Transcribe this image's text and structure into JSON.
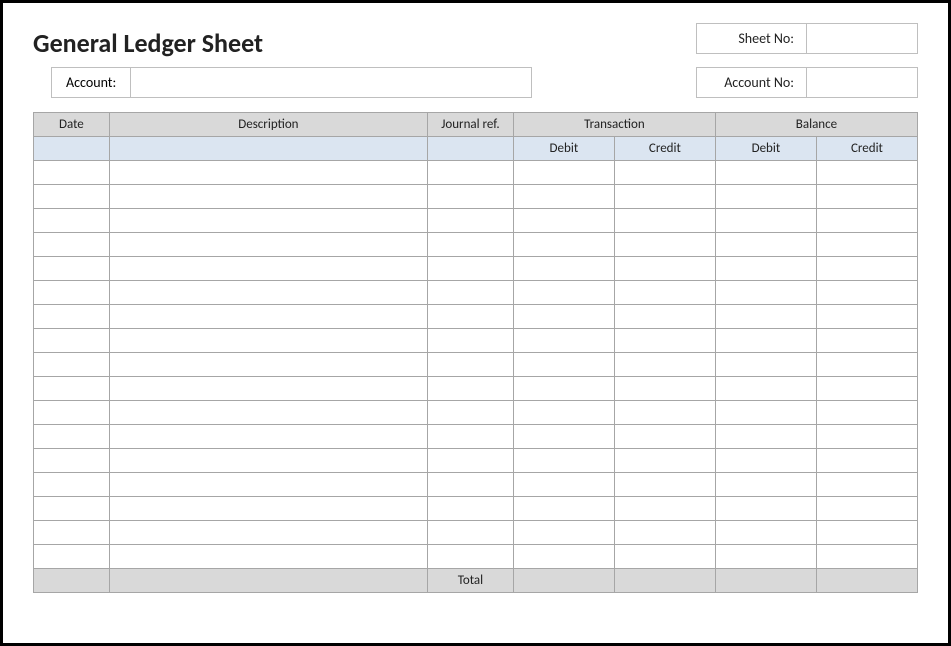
{
  "title": "General Ledger Sheet",
  "fields": {
    "sheet_no_label": "Sheet No:",
    "sheet_no_value": "",
    "account_label": "Account:",
    "account_value": "",
    "account_no_label": "Account No:",
    "account_no_value": ""
  },
  "columns": {
    "date": "Date",
    "description": "Description",
    "journal_ref": "Journal ref.",
    "transaction": "Transaction",
    "balance": "Balance",
    "debit": "Debit",
    "credit": "Credit"
  },
  "total_label": "Total",
  "row_count": 17
}
